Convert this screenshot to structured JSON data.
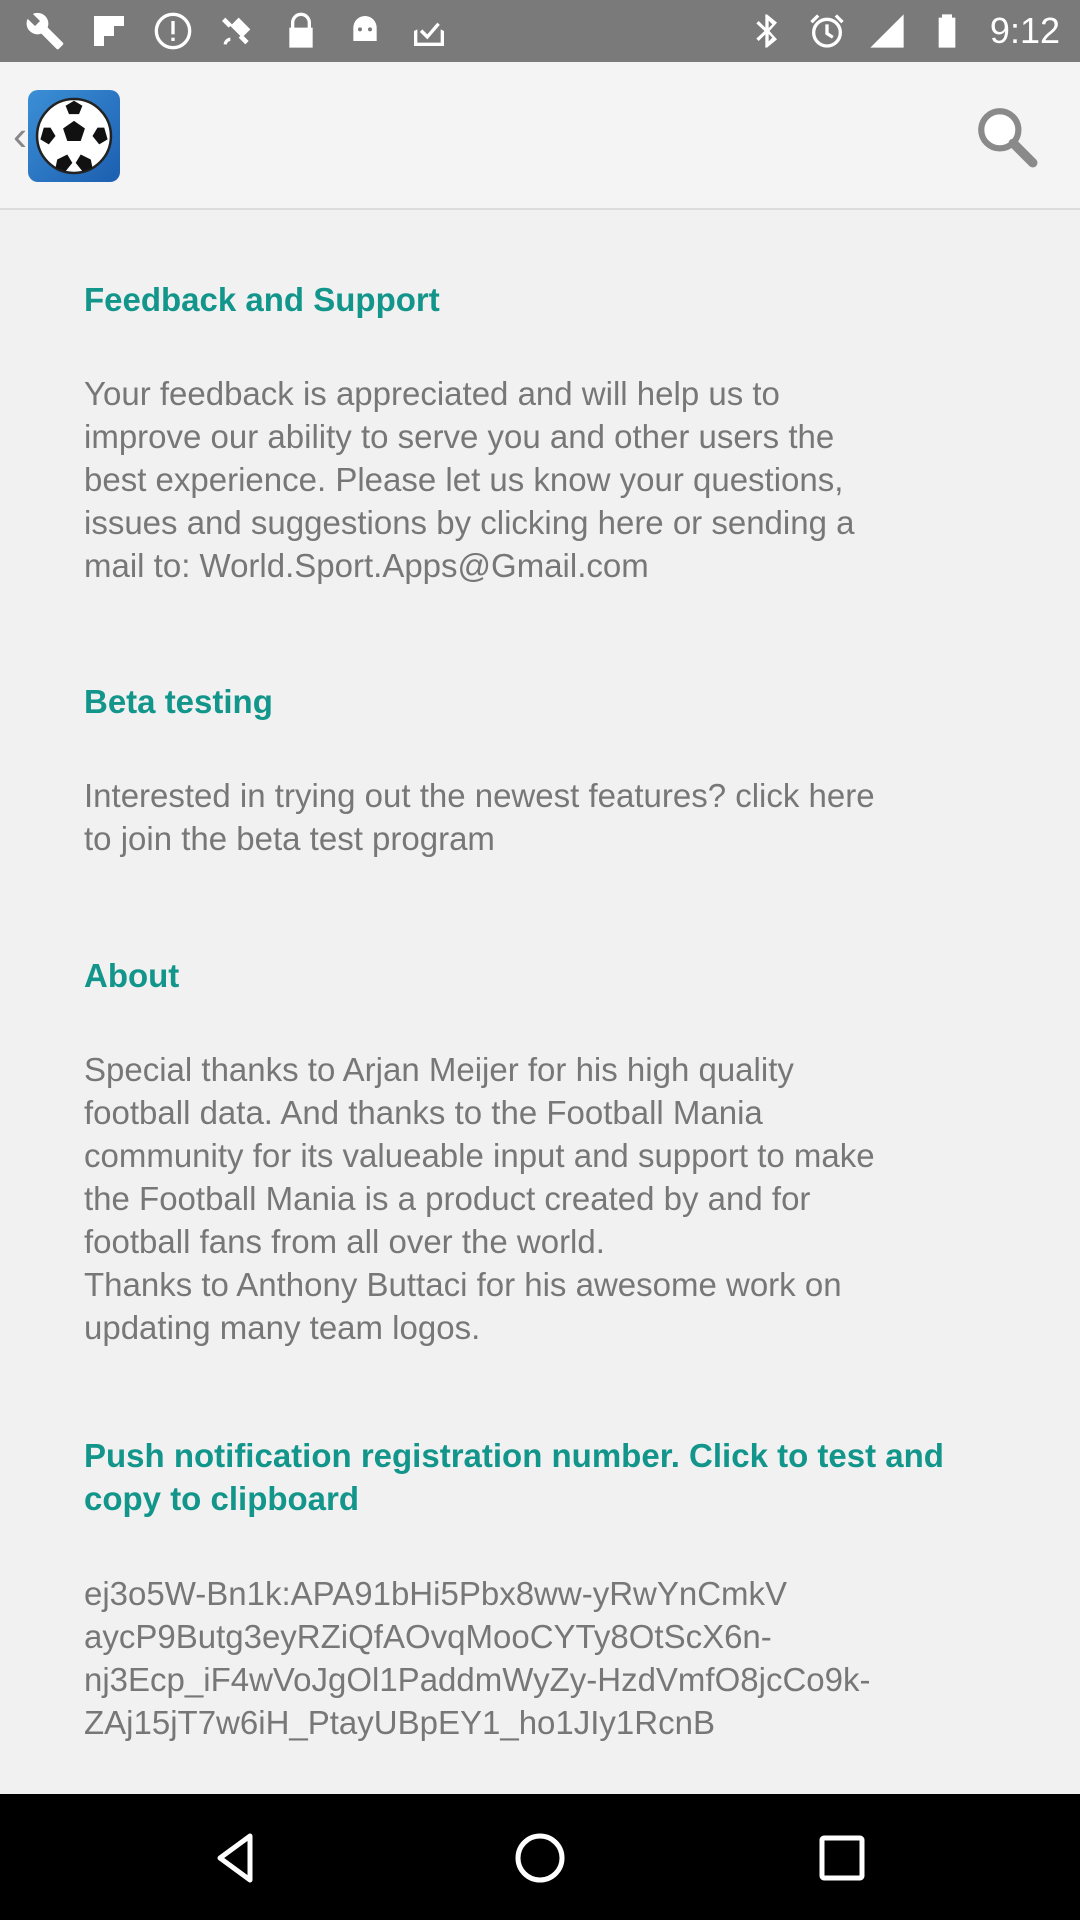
{
  "status_bar": {
    "time": "9:12",
    "left_icons": [
      "wrench-icon",
      "flipboard-icon",
      "alert-icon",
      "satellite-icon",
      "lock-icon",
      "android-icon",
      "inbox-check-icon"
    ],
    "right_icons": [
      "bluetooth-icon",
      "alarm-icon",
      "signal-icon",
      "battery-icon"
    ]
  },
  "app_bar": {
    "logo": "soccer-ball-icon",
    "search": "search-icon"
  },
  "sections": [
    {
      "title": "Feedback and Support",
      "body": "Your feedback is appreciated and will help us to\nimprove our ability to serve you and other users the\nbest experience. Please let us know your questions,\nissues and suggestions by clicking here or sending a\nmail to: World.Sport.Apps@Gmail.com"
    },
    {
      "title": "Beta testing",
      "body": "Interested in trying out the newest features? click here\nto join the beta test program"
    },
    {
      "title": "About",
      "body": "Special thanks to Arjan Meijer for his high quality\nfootball data. And thanks to the Football Mania\ncommunity for its valueable input and support to make\nthe Football Mania is a product created by and for\nfootball fans from all over the world.\nThanks to Anthony Buttaci for his awesome work on\nupdating many team logos."
    },
    {
      "title": "Push notification registration number. Click to test and\ncopy to clipboard",
      "body": "ej3o5W-Bn1k:APA91bHi5Pbx8ww-yRwYnCmkV\naycP9Butg3eyRZiQfAOvqMooCYTy8OtScX6n-\nnj3Ecp_iF4wVoJgOl1PaddmWyZy-HzdVmfO8jcCo9k-\nZAj15jT7w6iH_PtayUBpEY1_ho1JIy1RcnB"
    }
  ],
  "nav_bar": {
    "back": "back-triangle-icon",
    "home": "home-circle-icon",
    "recents": "recents-square-icon"
  },
  "colors": {
    "accent": "#12958a",
    "body_text": "#777777",
    "background": "#f1f1f1",
    "status_bar": "#7a7a7a"
  }
}
